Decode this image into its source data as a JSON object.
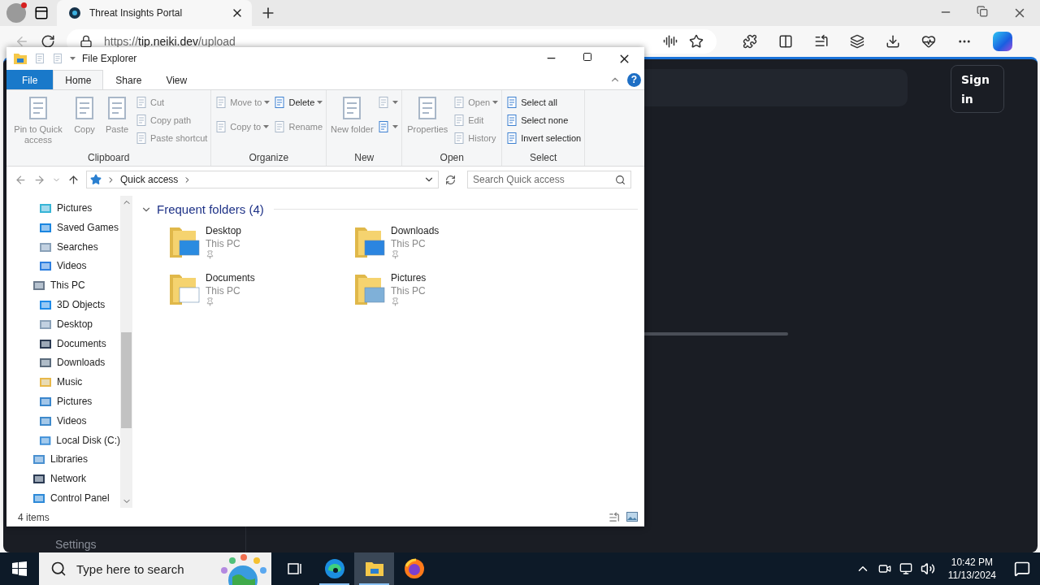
{
  "browser": {
    "tabs": [
      {
        "title": "Threat Insights Portal",
        "selected": true
      }
    ],
    "address": {
      "scheme": "https://",
      "host": "tip.neiki.dev",
      "path": "/upload"
    },
    "page": {
      "sign_in": "Sign in",
      "settings": "Settings"
    }
  },
  "explorer": {
    "title": "File Explorer",
    "ribbon_tabs": [
      {
        "label": "File",
        "kind": "menu",
        "selected": false
      },
      {
        "label": "Home",
        "kind": "tab",
        "selected": true
      },
      {
        "label": "Share",
        "kind": "tab",
        "selected": false
      },
      {
        "label": "View",
        "kind": "tab",
        "selected": false
      }
    ],
    "help": "?",
    "ribbon_groups": [
      {
        "name": "Clipboard",
        "items": [
          {
            "kind": "large",
            "label": "Pin to Quick access",
            "disabled": true
          },
          {
            "kind": "large",
            "label": "Copy",
            "disabled": true
          },
          {
            "kind": "large",
            "label": "Paste",
            "disabled": true
          },
          {
            "kind": "stack",
            "items": [
              {
                "label": "Cut",
                "disabled": true,
                "dropdown": false
              },
              {
                "label": "Copy path",
                "disabled": true,
                "dropdown": false
              },
              {
                "label": "Paste shortcut",
                "disabled": true,
                "dropdown": false
              }
            ]
          }
        ]
      },
      {
        "name": "Organize",
        "items": [
          {
            "kind": "stack",
            "items": [
              {
                "label": "Move to",
                "disabled": true,
                "dropdown": true
              },
              {
                "label": "Copy to",
                "disabled": true,
                "dropdown": true
              }
            ]
          },
          {
            "kind": "stack",
            "items": [
              {
                "label": "Delete",
                "disabled": false,
                "dropdown": true
              },
              {
                "label": "Rename",
                "disabled": true,
                "dropdown": false
              }
            ]
          }
        ]
      },
      {
        "name": "New",
        "items": [
          {
            "kind": "large",
            "label": "New folder",
            "disabled": true
          },
          {
            "kind": "stack",
            "items": [
              {
                "disabled": true,
                "dropdown": true
              },
              {
                "disabled": false,
                "dropdown": true
              }
            ]
          }
        ]
      },
      {
        "name": "Open",
        "items": [
          {
            "kind": "large",
            "label": "Properties",
            "disabled": true
          },
          {
            "kind": "stack",
            "items": [
              {
                "label": "Open",
                "disabled": true,
                "dropdown": true
              },
              {
                "label": "Edit",
                "disabled": true,
                "dropdown": false
              },
              {
                "label": "History",
                "disabled": true,
                "dropdown": false
              }
            ]
          }
        ]
      },
      {
        "name": "Select",
        "items": [
          {
            "kind": "stack",
            "items": [
              {
                "label": "Select all",
                "disabled": false,
                "dropdown": false
              },
              {
                "label": "Select none",
                "disabled": false,
                "dropdown": false
              },
              {
                "label": "Invert selection",
                "disabled": false,
                "dropdown": false
              }
            ]
          }
        ]
      }
    ],
    "path": [
      "Quick access"
    ],
    "search": {
      "placeholder": "Search Quick access"
    },
    "nav_tree": [
      {
        "children": [
          {
            "label": "Pictures"
          },
          {
            "label": "Saved Games"
          },
          {
            "label": "Searches"
          },
          {
            "label": "Videos"
          }
        ]
      },
      {
        "label": "This PC",
        "children": [
          {
            "label": "3D Objects"
          },
          {
            "label": "Desktop"
          },
          {
            "label": "Documents"
          },
          {
            "label": "Downloads"
          },
          {
            "label": "Music"
          },
          {
            "label": "Pictures"
          },
          {
            "label": "Videos"
          },
          {
            "label": "Local Disk (C:)"
          }
        ]
      },
      {
        "label": "Libraries"
      },
      {
        "label": "Network"
      },
      {
        "label": "Control Panel"
      }
    ],
    "section": {
      "title": "Frequent folders (4)",
      "expanded": true
    },
    "folders": [
      {
        "name": "Desktop",
        "location": "This PC",
        "pinned": true
      },
      {
        "name": "Downloads",
        "location": "This PC",
        "pinned": true
      },
      {
        "name": "Documents",
        "location": "This PC",
        "pinned": true
      },
      {
        "name": "Pictures",
        "location": "This PC",
        "pinned": true
      }
    ],
    "status": "4 items"
  },
  "taskbar": {
    "search_placeholder": "Type here to search",
    "apps": [
      {
        "kind": "taskview",
        "running": false,
        "selected": false
      },
      {
        "kind": "edge",
        "running": true,
        "selected": false
      },
      {
        "kind": "explorer",
        "running": true,
        "selected": true
      },
      {
        "kind": "firefox",
        "running": false,
        "selected": false
      }
    ],
    "time": "10:42 PM",
    "date": "11/13/2024"
  }
}
